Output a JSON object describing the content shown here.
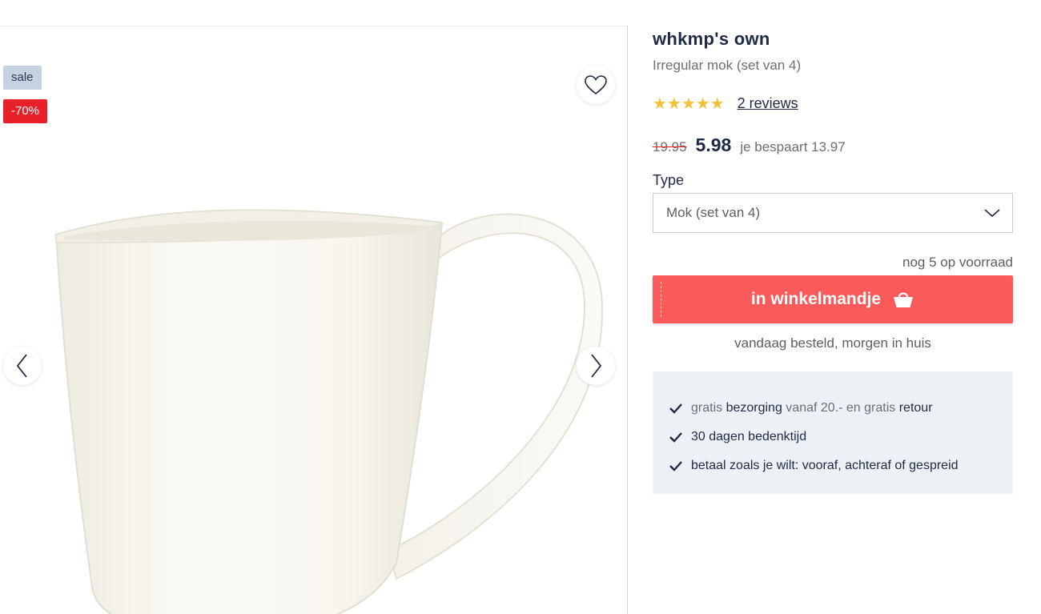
{
  "gallery": {
    "badges": {
      "sale": "sale",
      "discount": "-70%"
    },
    "icons": {
      "favorite": "heart-outline-icon",
      "previous": "chevron-left-icon",
      "next": "chevron-right-icon"
    },
    "image": "white-irregular-mug"
  },
  "product": {
    "brand": "whkmp's own",
    "name": "Irregular mok (set van 4)",
    "rating": {
      "stars": "★★★★★",
      "value": 5,
      "max": 5,
      "reviews_label": "2 reviews"
    },
    "price": {
      "old": "19.95",
      "current": "5.98",
      "savings": "je bespaart 13.97"
    },
    "type": {
      "label": "Type",
      "selected": "Mok (set van 4)"
    },
    "stock": "nog 5 op voorraad",
    "cart_button": "in winkelmandje",
    "delivery": "vandaag besteld, morgen in huis"
  },
  "usps": [
    {
      "parts": [
        {
          "text": "gratis ",
          "style": "muted"
        },
        {
          "text": "bezorging",
          "style": "normal"
        },
        {
          "text": " vanaf 20.- en gratis ",
          "style": "muted"
        },
        {
          "text": "retour",
          "style": "normal"
        }
      ]
    },
    {
      "parts": [
        {
          "text": "30 dagen bedenktijd",
          "style": "normal"
        }
      ]
    },
    {
      "parts": [
        {
          "text": "betaal zoals je wilt: vooraf, achteraf of gespreid",
          "style": "normal"
        }
      ]
    }
  ],
  "colors": {
    "accent": "#fa5a5a",
    "discount": "#e8202a",
    "sale_badge": "#c4d2e1",
    "star": "#f4c13a",
    "text_dark": "#1f2a44",
    "usp_background": "#edf1f5"
  }
}
